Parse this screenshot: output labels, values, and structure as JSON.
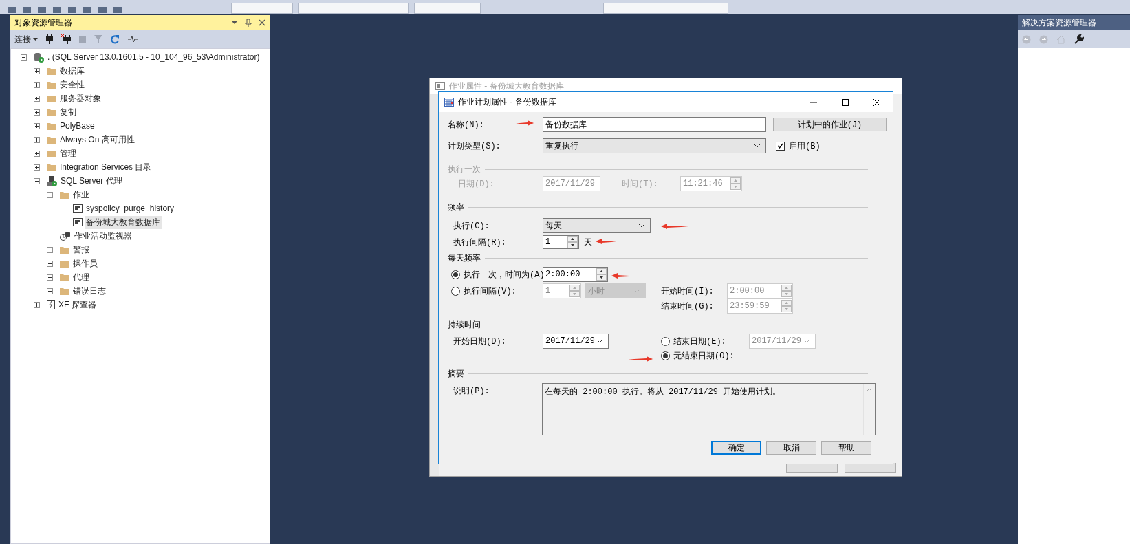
{
  "object_explorer": {
    "title": "对象资源管理器",
    "connect_label": "连接",
    "tree": [
      {
        "label": ". (SQL Server 13.0.1601.5 - 10_104_96_53\\Administrator)",
        "kind": "server",
        "expanded": true,
        "selected": false,
        "children": [
          {
            "label": "数据库",
            "kind": "folder",
            "expanded": false,
            "selected": false
          },
          {
            "label": "安全性",
            "kind": "folder",
            "expanded": false,
            "selected": false
          },
          {
            "label": "服务器对象",
            "kind": "folder",
            "expanded": false,
            "selected": false
          },
          {
            "label": "复制",
            "kind": "folder",
            "expanded": false,
            "selected": false
          },
          {
            "label": "PolyBase",
            "kind": "folder",
            "expanded": false,
            "selected": false
          },
          {
            "label": "Always On 高可用性",
            "kind": "folder",
            "expanded": false,
            "selected": false
          },
          {
            "label": "管理",
            "kind": "folder",
            "expanded": false,
            "selected": false
          },
          {
            "label": "Integration Services 目录",
            "kind": "folder",
            "expanded": false,
            "selected": false
          },
          {
            "label": "SQL Server 代理",
            "kind": "agent",
            "expanded": true,
            "selected": false,
            "children": [
              {
                "label": "作业",
                "kind": "folder",
                "expanded": true,
                "selected": false,
                "children": [
                  {
                    "label": "syspolicy_purge_history",
                    "kind": "job",
                    "selected": false
                  },
                  {
                    "label": "备份城大教育数据库",
                    "kind": "job",
                    "selected": true
                  }
                ]
              },
              {
                "label": "作业活动监视器",
                "kind": "monitor",
                "selected": false
              },
              {
                "label": "警报",
                "kind": "folder",
                "expanded": false,
                "selected": false
              },
              {
                "label": "操作员",
                "kind": "folder",
                "expanded": false,
                "selected": false
              },
              {
                "label": "代理",
                "kind": "folder",
                "expanded": false,
                "selected": false
              },
              {
                "label": "错误日志",
                "kind": "folder",
                "expanded": false,
                "selected": false
              }
            ]
          },
          {
            "label": "XE 探查器",
            "kind": "xe",
            "expanded": false,
            "selected": false
          }
        ]
      }
    ]
  },
  "background_window": {
    "title": "作业属性 - 备份城大教育数据库"
  },
  "dialog": {
    "title": "作业计划属性 - 备份数据库",
    "name": {
      "label": "名称(N):",
      "value": "备份数据库"
    },
    "jobs_button": "计划中的作业(J)",
    "schedule_type": {
      "label": "计划类型(S):",
      "value": "重复执行"
    },
    "enabled": {
      "label": "启用(B)",
      "checked": true
    },
    "one_time": {
      "heading": "执行一次",
      "disabled": true,
      "date_label": "日期(D):",
      "date_value": "2017/11/29",
      "time_label": "时间(T):",
      "time_value": "11:21:46"
    },
    "frequency": {
      "heading": "频率",
      "occurs_label": "执行(C):",
      "occurs_value": "每天",
      "recurs_label": "执行间隔(R):",
      "recurs_value": "1",
      "recurs_unit": "天"
    },
    "daily_frequency": {
      "heading": "每天频率",
      "options": [
        {
          "kind": "once",
          "label": "执行一次，时间为(A)",
          "selected": true,
          "value": "2:00:00"
        },
        {
          "kind": "every",
          "label": "执行间隔(V):",
          "selected": false,
          "value": "1",
          "unit": "小时",
          "start_label": "开始时间(I):",
          "start_value": "2:00:00",
          "end_label": "结束时间(G):",
          "end_value": "23:59:59"
        }
      ]
    },
    "duration": {
      "heading": "持续时间",
      "start_label": "开始日期(D):",
      "start_value": "2017/11/29",
      "end_options": [
        {
          "kind": "end_date",
          "label": "结束日期(E):",
          "selected": false,
          "value": "2017/11/29"
        },
        {
          "kind": "no_end",
          "label": "无结束日期(O):",
          "selected": true
        }
      ]
    },
    "summary": {
      "heading": "摘要",
      "label": "说明(P):",
      "value": "在每天的 2:00:00 执行。将从 2017/11/29 开始使用计划。"
    },
    "buttons": [
      {
        "label": "确定",
        "default": true
      },
      {
        "label": "取消",
        "default": false
      },
      {
        "label": "帮助",
        "default": false
      }
    ]
  },
  "solution_explorer": {
    "title": "解决方案资源管理器"
  }
}
